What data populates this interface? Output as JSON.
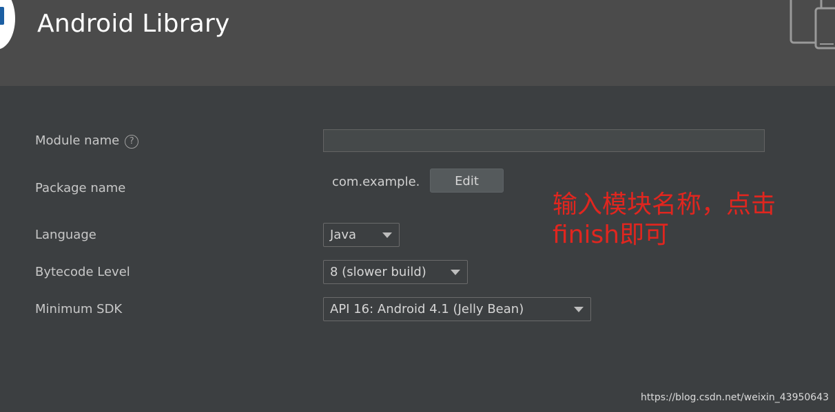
{
  "header": {
    "title": "Android Library"
  },
  "form": {
    "module_name": {
      "label": "Module name",
      "help": "?",
      "value": ""
    },
    "package_name": {
      "label": "Package name",
      "value": "com.example.",
      "edit_label": "Edit"
    },
    "language": {
      "label": "Language",
      "value": "Java"
    },
    "bytecode_level": {
      "label": "Bytecode Level",
      "value": "8 (slower build)"
    },
    "minimum_sdk": {
      "label": "Minimum SDK",
      "value": "API 16: Android 4.1 (Jelly Bean)"
    }
  },
  "annotation": {
    "line1": "输入模块名称，点击",
    "line2": "finish即可"
  },
  "watermark": "https://blog.csdn.net/weixin_43950643",
  "colors": {
    "background": "#3c3f41",
    "header": "#4b4b4b",
    "annotation": "#e0261f"
  },
  "icons": {
    "app_logo": "android-studio-logo-icon",
    "device": "tablet-phone-icon",
    "help": "question-circle-icon",
    "dropdown": "chevron-down-icon"
  }
}
